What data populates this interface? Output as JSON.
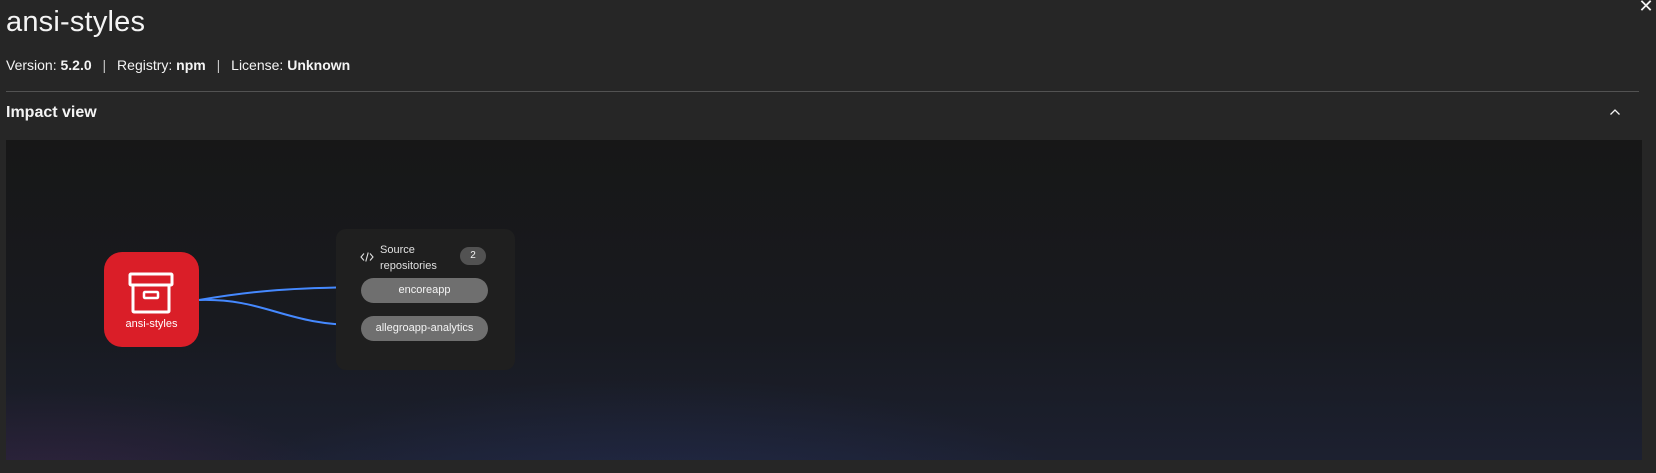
{
  "header": {
    "title": "ansi-styles",
    "close_glyph": "✕"
  },
  "meta": {
    "version_label": "Version:",
    "version_value": "5.2.0",
    "registry_label": "Registry:",
    "registry_value": "npm",
    "license_label": "License:",
    "license_value": "Unknown",
    "separator": "|"
  },
  "section": {
    "title": "Impact view",
    "expanded": true,
    "toggle_icon": "chevron-up-icon"
  },
  "graph": {
    "package_node": {
      "label": "ansi-styles",
      "icon": "archive-box-icon",
      "color": "#da1e28"
    },
    "group": {
      "icon": "code-icon",
      "title": "Source repositories",
      "count": "2",
      "repositories": [
        "encoreapp",
        "allegroapp-analytics"
      ]
    },
    "edge_color": "#4589ff"
  },
  "colors": {
    "background": "#262626",
    "pill": "#6f6f6f",
    "badge": "#525252"
  }
}
